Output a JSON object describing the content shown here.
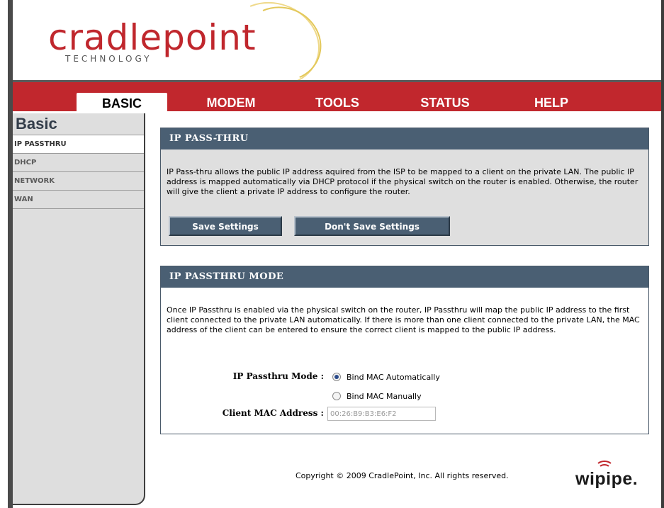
{
  "brand": {
    "name": "cradlepoint",
    "subtitle": "TECHNOLOGY"
  },
  "nav": {
    "tabs": [
      {
        "label": "BASIC",
        "active": true
      },
      {
        "label": "MODEM",
        "active": false
      },
      {
        "label": "TOOLS",
        "active": false
      },
      {
        "label": "STATUS",
        "active": false
      },
      {
        "label": "HELP",
        "active": false
      }
    ]
  },
  "sidebar": {
    "title": "Basic",
    "items": [
      {
        "label": "IP PASSTHRU",
        "active": true
      },
      {
        "label": "DHCP",
        "active": false
      },
      {
        "label": "NETWORK",
        "active": false
      },
      {
        "label": "WAN",
        "active": false
      }
    ]
  },
  "passthru_panel": {
    "heading": "IP PASS-THRU",
    "description": "IP Pass-thru allows the public IP address aquired from the ISP to be mapped to a client on the private LAN. The public IP address is mapped automatically via DHCP protocol if the physical switch on the router is enabled. Otherwise, the router will give the client a private IP address to configure the router.",
    "save_label": "Save Settings",
    "dont_save_label": "Don't Save Settings"
  },
  "mode_panel": {
    "heading": "IP PASSTHRU MODE",
    "description": "Once IP Passthru is enabled via the physical switch on the router, IP Passthru will map the public IP address to the first client connected to the private LAN automatically. If there is more than one client connected to the private LAN, the MAC address of the client can be entered to ensure the correct client is mapped to the public IP address.",
    "mode_label": "IP Passthru Mode :",
    "option_auto": "Bind MAC Automatically",
    "option_manual": "Bind MAC Manually",
    "selected_option": "Bind MAC Automatically",
    "mac_label": "Client MAC Address :",
    "mac_value": "00:26:B9:B3:E6:F2"
  },
  "footer": {
    "copyright": "Copyright © 2009 CradlePoint, Inc. All rights reserved.",
    "partner_logo": "wipipe."
  },
  "colors": {
    "nav_red": "#c1272d",
    "panel_header": "#4a5f73",
    "sidebar_bg": "#dedede"
  }
}
